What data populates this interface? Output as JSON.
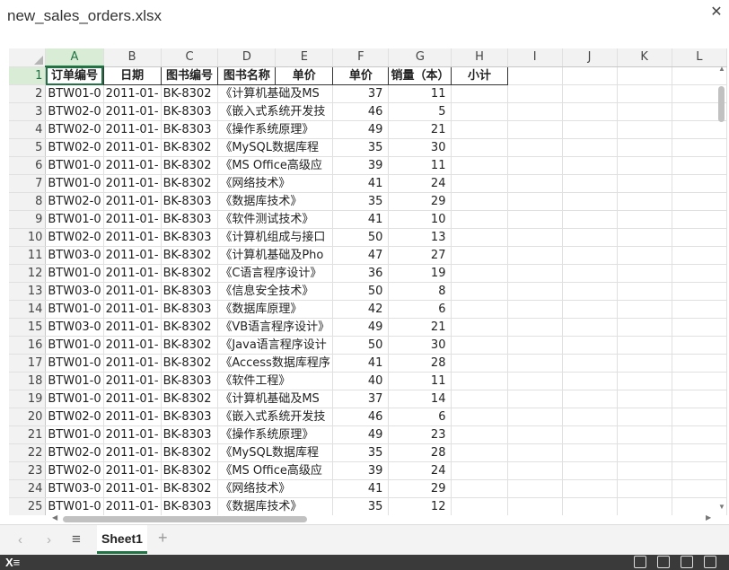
{
  "window": {
    "title": "new_sales_orders.xlsx",
    "close_glyph": "✕"
  },
  "columns": [
    "A",
    "B",
    "C",
    "D",
    "E",
    "F",
    "G",
    "H",
    "I",
    "J",
    "K",
    "L"
  ],
  "header_row": [
    "订单编号",
    "日期",
    "图书编号",
    "图书名称",
    "单价",
    "单价",
    "销量（本）",
    "小计"
  ],
  "rows": [
    [
      "BTW01-0",
      "2011-01-",
      "BK-8302",
      "《计算机基础及MS",
      "37",
      "11"
    ],
    [
      "BTW02-0",
      "2011-01-",
      "BK-8303",
      "《嵌入式系统开发技",
      "46",
      "5"
    ],
    [
      "BTW02-0",
      "2011-01-",
      "BK-8303",
      "《操作系统原理》",
      "49",
      "21"
    ],
    [
      "BTW02-0",
      "2011-01-",
      "BK-8302",
      "《MySQL数据库程",
      "35",
      "30"
    ],
    [
      "BTW01-0",
      "2011-01-",
      "BK-8302",
      "《MS Office高级应",
      "39",
      "11"
    ],
    [
      "BTW01-0",
      "2011-01-",
      "BK-8302",
      "《网络技术》",
      "41",
      "24"
    ],
    [
      "BTW02-0",
      "2011-01-",
      "BK-8303",
      "《数据库技术》",
      "35",
      "29"
    ],
    [
      "BTW01-0",
      "2011-01-",
      "BK-8303",
      "《软件测试技术》",
      "41",
      "10"
    ],
    [
      "BTW02-0",
      "2011-01-",
      "BK-8303",
      "《计算机组成与接口",
      "50",
      "13"
    ],
    [
      "BTW03-0",
      "2011-01-",
      "BK-8302",
      "《计算机基础及Pho",
      "47",
      "27"
    ],
    [
      "BTW01-0",
      "2011-01-",
      "BK-8302",
      "《C语言程序设计》",
      "36",
      "19"
    ],
    [
      "BTW03-0",
      "2011-01-",
      "BK-8303",
      "《信息安全技术》",
      "50",
      "8"
    ],
    [
      "BTW01-0",
      "2011-01-",
      "BK-8303",
      "《数据库原理》",
      "42",
      "6"
    ],
    [
      "BTW03-0",
      "2011-01-",
      "BK-8302",
      "《VB语言程序设计》",
      "49",
      "21"
    ],
    [
      "BTW01-0",
      "2011-01-",
      "BK-8302",
      "《Java语言程序设计",
      "50",
      "30"
    ],
    [
      "BTW01-0",
      "2011-01-",
      "BK-8302",
      "《Access数据库程序",
      "41",
      "28"
    ],
    [
      "BTW01-0",
      "2011-01-",
      "BK-8303",
      "《软件工程》",
      "40",
      "11"
    ],
    [
      "BTW01-0",
      "2011-01-",
      "BK-8302",
      "《计算机基础及MS",
      "37",
      "14"
    ],
    [
      "BTW02-0",
      "2011-01-",
      "BK-8303",
      "《嵌入式系统开发技",
      "46",
      "6"
    ],
    [
      "BTW01-0",
      "2011-01-",
      "BK-8303",
      "《操作系统原理》",
      "49",
      "23"
    ],
    [
      "BTW02-0",
      "2011-01-",
      "BK-8302",
      "《MySQL数据库程",
      "35",
      "28"
    ],
    [
      "BTW02-0",
      "2011-01-",
      "BK-8302",
      "《MS Office高级应",
      "39",
      "24"
    ],
    [
      "BTW03-0",
      "2011-01-",
      "BK-8302",
      "《网络技术》",
      "41",
      "29"
    ],
    [
      "BTW01-0",
      "2011-01-",
      "BK-8303",
      "《数据库技术》",
      "35",
      "12"
    ]
  ],
  "tabs": {
    "sheet1": "Sheet1",
    "add_glyph": "+",
    "prev_glyph": "‹",
    "next_glyph": "›",
    "menu_glyph": "≡"
  },
  "status": {
    "app_glyph": "X≡"
  },
  "colors": {
    "accent": "#217346",
    "status_bg": "#3a3a3a"
  },
  "icons": [
    "close-icon",
    "sheet-nav-prev-icon",
    "sheet-nav-next-icon",
    "sheet-menu-icon",
    "add-sheet-icon",
    "excel-app-icon",
    "normal-view-icon",
    "page-layout-icon",
    "page-break-icon",
    "fullscreen-icon"
  ]
}
